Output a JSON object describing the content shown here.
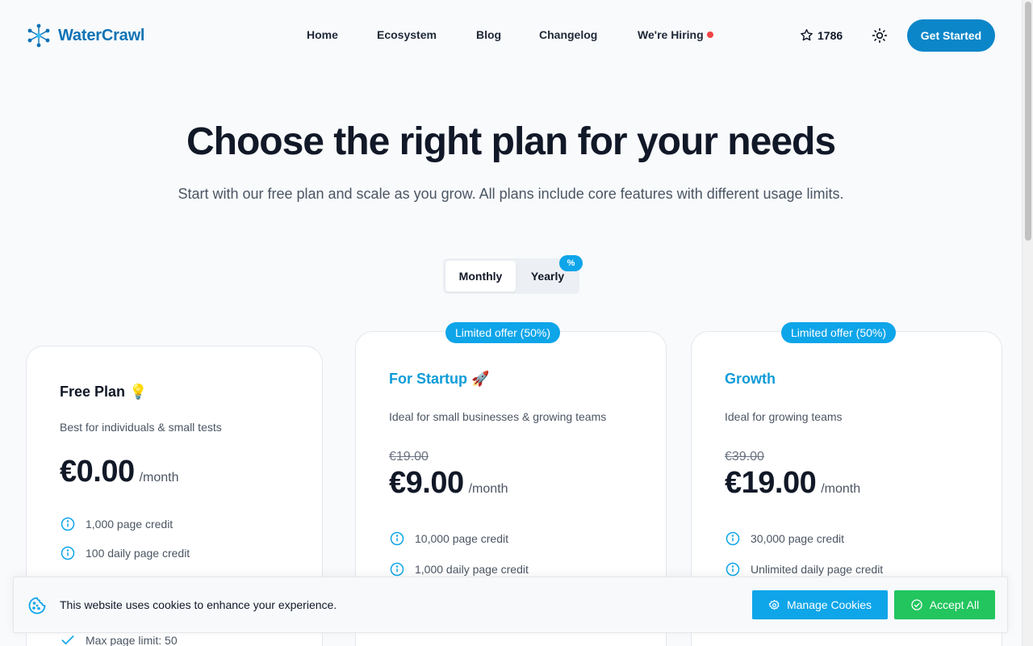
{
  "brand": {
    "name": "WaterCrawl",
    "icon": "network-hexagon-icon"
  },
  "nav": [
    {
      "label": "Home"
    },
    {
      "label": "Ecosystem"
    },
    {
      "label": "Blog"
    },
    {
      "label": "Changelog"
    },
    {
      "label": "We're Hiring"
    }
  ],
  "header": {
    "stars": "1786",
    "star_icon": "star-icon",
    "theme_icon": "sun-icon",
    "cta": "Get Started"
  },
  "hero": {
    "title": "Choose the right plan for your needs",
    "subtitle": "Start with our free plan and scale as you grow. All plans include core features with different usage limits."
  },
  "billing_toggle": {
    "monthly": "Monthly",
    "yearly": "Yearly",
    "yearly_badge": "%",
    "selected": "Monthly"
  },
  "plans": [
    {
      "title": "Free Plan",
      "emoji": "💡",
      "description": "Best for individuals & small tests",
      "price": "€0.00",
      "unit": "/month",
      "features": [
        {
          "icon": "info-icon",
          "text": "1,000 page credit"
        },
        {
          "icon": "info-icon",
          "text": "100 daily page credit"
        },
        {
          "icon": "check-icon",
          "text": "Max page limit: 50"
        }
      ]
    },
    {
      "title": "For Startup",
      "emoji": "🚀",
      "badge": "Limited offer (50%)",
      "description": "Ideal for small businesses & growing teams",
      "old_price": "€19.00",
      "price": "€9.00",
      "unit": "/month",
      "features": [
        {
          "icon": "info-icon",
          "text": "10,000 page credit"
        },
        {
          "icon": "info-icon",
          "text": "1,000 daily page credit"
        }
      ]
    },
    {
      "title": "Growth",
      "badge": "Limited offer (50%)",
      "description": "Ideal for growing teams",
      "old_price": "€39.00",
      "price": "€19.00",
      "unit": "/month",
      "features": [
        {
          "icon": "info-icon",
          "text": "30,000 page credit"
        },
        {
          "icon": "info-icon",
          "text": "Unlimited daily page credit"
        }
      ]
    }
  ],
  "cookie_banner": {
    "icon": "cookie-icon",
    "text": "This website uses cookies to enhance your experience.",
    "manage_label": "Manage Cookies",
    "accept_label": "Accept All"
  },
  "colors": {
    "brand": "#0e73b5",
    "accent": "#0ea5e9",
    "accept": "#22c55e",
    "hiring_dot": "#ef4444"
  }
}
